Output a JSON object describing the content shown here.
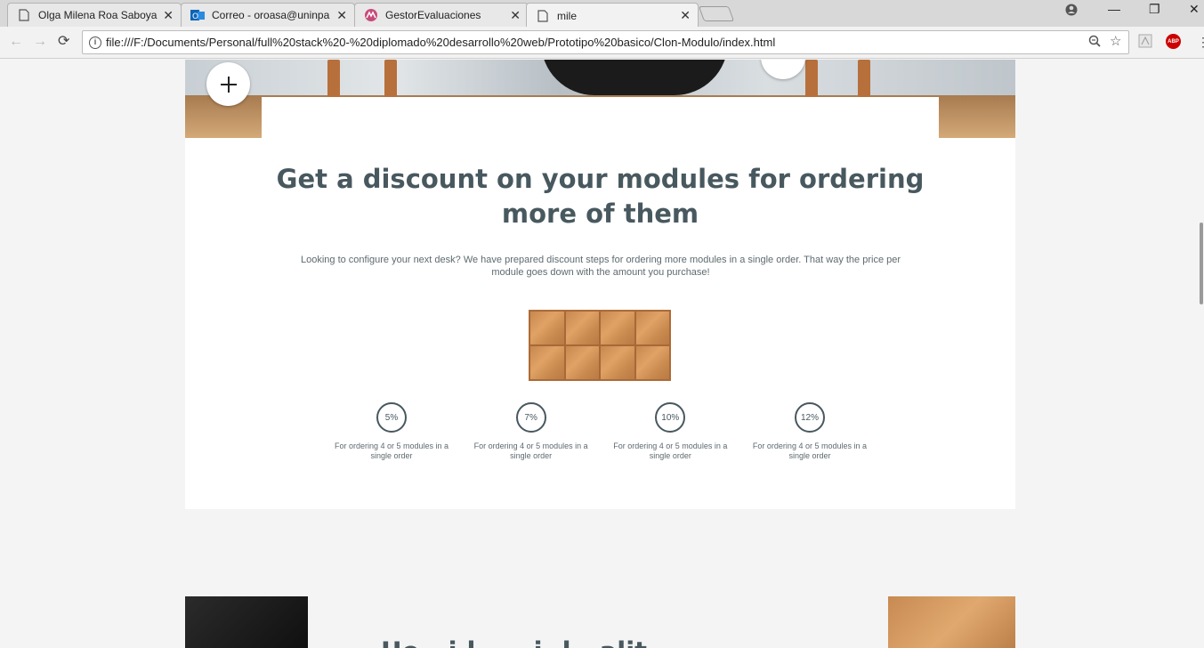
{
  "browser": {
    "tabs": [
      {
        "title": "Olga Milena Roa Saboya",
        "icon": "document-icon",
        "active": false
      },
      {
        "title": "Correo - oroasa@uninpa",
        "icon": "outlook-icon",
        "active": false
      },
      {
        "title": "GestorEvaluaciones",
        "icon": "gestor-app-icon",
        "active": false
      },
      {
        "title": "mile",
        "icon": "document-icon",
        "active": true
      }
    ],
    "close_glyph": "✕",
    "url": "file:///F:/Documents/Personal/full%20stack%20-%20diplomado%20desarrollo%20web/Prototipo%20basico/Clon-Modulo/index.html",
    "abp_label": "ABP"
  },
  "page": {
    "heading": "Get a discount on your modules for ordering more of them",
    "intro": "Looking to configure your next desk? We have prepared discount steps for ordering more modules in a single order. That way the price per module goes down with the amount you purchase!",
    "discounts": [
      {
        "percent": "5%",
        "text": "For ordering 4 or 5 modules in a single order"
      },
      {
        "percent": "7%",
        "text": "For ordering 4 or 5 modules in a single order"
      },
      {
        "percent": "10%",
        "text": "For ordering 4 or 5 modules in a single order"
      },
      {
        "percent": "12%",
        "text": "For ordering 4 or 5 modules in a single order"
      }
    ],
    "module_grid": {
      "columns": 4,
      "rows": 2
    },
    "next_heading_partial": "Uo        ..i.l..  ...i..l  ..alit."
  },
  "colors": {
    "heading": "#48585f",
    "body_text": "#5e6a6f",
    "page_bg": "#f4f4f4",
    "wood": "#d29a60"
  }
}
